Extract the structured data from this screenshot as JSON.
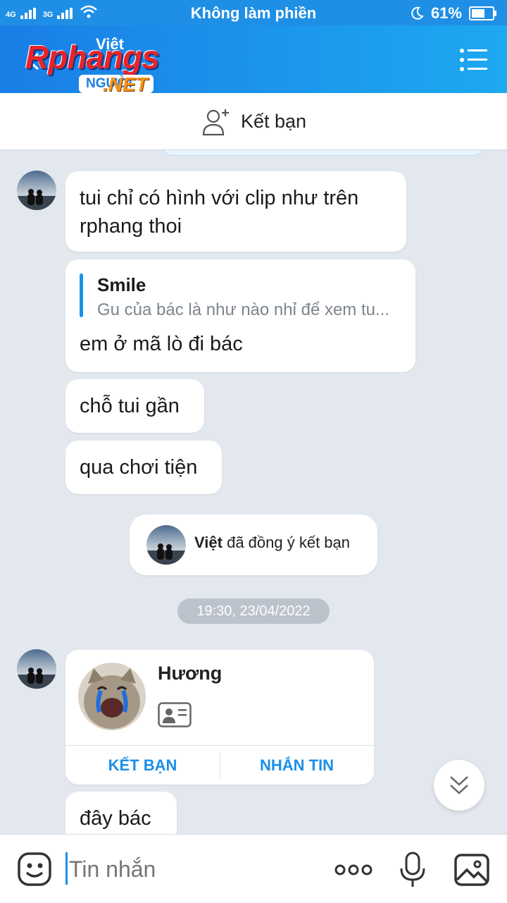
{
  "status_bar": {
    "network_1": "4G",
    "network_2": "3G",
    "mode": "Không làm phiền",
    "battery": "61%"
  },
  "header": {
    "logo_main": "Rphangs",
    "logo_sub1": "Việt",
    "logo_sub2": "NGƯỜI",
    "logo_sub3": ".NET"
  },
  "friend_bar": {
    "label": "Kết bạn"
  },
  "messages": [
    {
      "text": "tui chỉ có hình với clip như trên rphang thoi"
    },
    {
      "quote_name": "Smile",
      "quote_text": "Gu của bác là như nào nhỉ để xem tu...",
      "text": "em ở mã lò đi bác"
    },
    {
      "text": "chỗ tui gần"
    },
    {
      "text": "qua chơi tiện"
    },
    {
      "text": "đây bác"
    }
  ],
  "system_notice": {
    "name": "Việt",
    "text": "đã đồng ý kết bạn"
  },
  "timestamp": "19:30, 23/04/2022",
  "contact_card": {
    "name": "Hương",
    "add_friend_label": "KẾT BẠN",
    "message_label": "NHẮN TIN"
  },
  "input_bar": {
    "placeholder": "Tin nhắn"
  },
  "colors": {
    "accent": "#1a8fe8",
    "header_start": "#1a7ee6",
    "header_end": "#1da9f0",
    "chat_bg": "#e3e8ef"
  }
}
